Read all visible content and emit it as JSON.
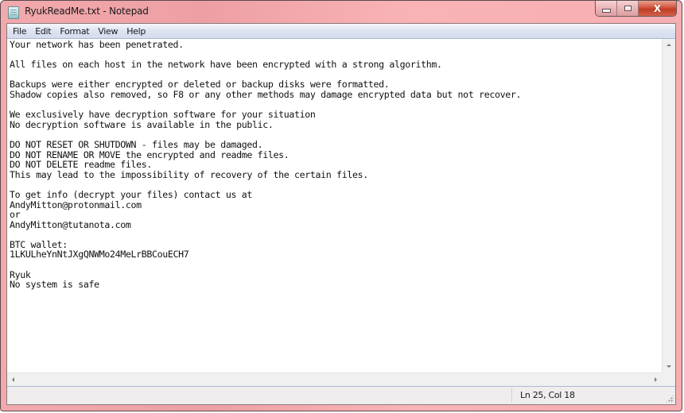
{
  "window": {
    "title": "RyukReadMe.txt - Notepad",
    "app_icon": "notepad-icon",
    "caption_buttons": {
      "minimize": "minimize-icon",
      "maximize": "maximize-icon",
      "close": "close-icon",
      "close_glyph": "X"
    }
  },
  "menu": {
    "items": [
      {
        "label": "File"
      },
      {
        "label": "Edit"
      },
      {
        "label": "Format"
      },
      {
        "label": "View"
      },
      {
        "label": "Help"
      }
    ]
  },
  "document": {
    "lines": [
      "Your network has been penetrated.",
      "",
      "All files on each host in the network have been encrypted with a strong algorithm.",
      "",
      "Backups were either encrypted or deleted or backup disks were formatted.",
      "Shadow copies also removed, so F8 or any other methods may damage encrypted data but not recover.",
      "",
      "We exclusively have decryption software for your situation",
      "No decryption software is available in the public.",
      "",
      "DO NOT RESET OR SHUTDOWN - files may be damaged.",
      "DO NOT RENAME OR MOVE the encrypted and readme files.",
      "DO NOT DELETE readme files.",
      "This may lead to the impossibility of recovery of the certain files.",
      "",
      "To get info (decrypt your files) contact us at",
      "AndyMitton@protonmail.com",
      "or",
      "AndyMitton@tutanota.com",
      "",
      "BTC wallet:",
      "1LKULheYnNtJXgQNWMo24MeLrBBCouECH7",
      "",
      "Ryuk",
      "No system is safe"
    ]
  },
  "statusbar": {
    "position": "Ln 25, Col 18"
  },
  "colors": {
    "frame": "#f2a9ad",
    "close_button": "#c93f25",
    "menubar": "#dde4f2"
  }
}
